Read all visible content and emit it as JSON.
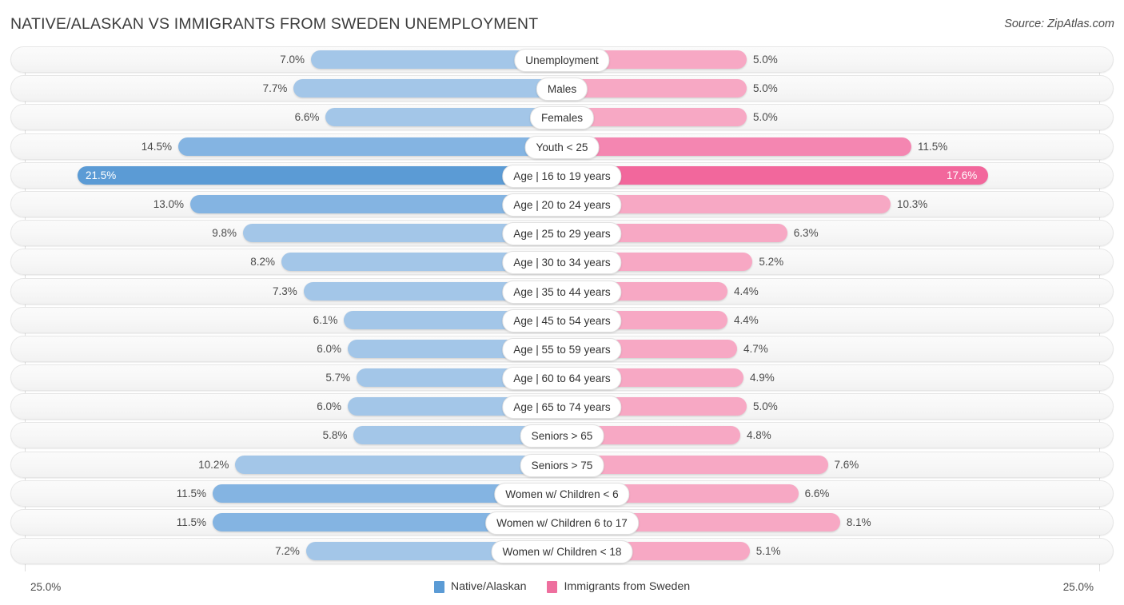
{
  "header": {
    "title": "NATIVE/ALASKAN VS IMMIGRANTS FROM SWEDEN UNEMPLOYMENT",
    "source": "Source: ZipAtlas.com"
  },
  "axis": {
    "left_label": "25.0%",
    "right_label": "25.0%",
    "max": 25.0
  },
  "legend": [
    {
      "label": "Native/Alaskan",
      "color": "#5b9bd5"
    },
    {
      "label": "Immigrants from Sweden",
      "color": "#ee6f9e"
    }
  ],
  "colors": {
    "left_light": "#a3c6e8",
    "left_mid": "#84b4e2",
    "left_strong": "#5b9bd5",
    "right_light": "#f7a8c4",
    "right_mid": "#f486b1",
    "right_strong": "#f2679c",
    "track": "#f7f7f7",
    "gridline": "#dedede"
  },
  "chart_data": {
    "type": "bar",
    "title": "NATIVE/ALASKAN VS IMMIGRANTS FROM SWEDEN UNEMPLOYMENT",
    "subtitle": "",
    "xlabel": "",
    "ylabel": "",
    "orientation": "horizontal-diverging",
    "xlim": [
      0,
      25.0
    ],
    "grid": true,
    "legend_position": "bottom-center",
    "categories": [
      "Unemployment",
      "Males",
      "Females",
      "Youth < 25",
      "Age | 16 to 19 years",
      "Age | 20 to 24 years",
      "Age | 25 to 29 years",
      "Age | 30 to 34 years",
      "Age | 35 to 44 years",
      "Age | 45 to 54 years",
      "Age | 55 to 59 years",
      "Age | 60 to 64 years",
      "Age | 65 to 74 years",
      "Seniors > 65",
      "Seniors > 75",
      "Women w/ Children < 6",
      "Women w/ Children 6 to 17",
      "Women w/ Children < 18"
    ],
    "series": [
      {
        "name": "Native/Alaskan",
        "color": "#5b9bd5",
        "values": [
          7.0,
          7.7,
          6.6,
          14.5,
          21.5,
          13.0,
          9.8,
          8.2,
          7.3,
          6.1,
          6.0,
          5.7,
          6.0,
          5.8,
          10.2,
          11.5,
          11.5,
          7.2
        ],
        "labels": [
          "7.0%",
          "7.7%",
          "6.6%",
          "14.5%",
          "21.5%",
          "13.0%",
          "9.8%",
          "8.2%",
          "7.3%",
          "6.1%",
          "6.0%",
          "5.7%",
          "6.0%",
          "5.8%",
          "10.2%",
          "11.5%",
          "11.5%",
          "7.2%"
        ]
      },
      {
        "name": "Immigrants from Sweden",
        "color": "#ee6f9e",
        "values": [
          5.0,
          5.0,
          5.0,
          11.5,
          17.6,
          10.3,
          6.3,
          5.2,
          4.4,
          4.4,
          4.7,
          4.9,
          5.0,
          4.8,
          7.6,
          6.6,
          8.1,
          5.1
        ],
        "labels": [
          "5.0%",
          "5.0%",
          "5.0%",
          "11.5%",
          "17.6%",
          "10.3%",
          "6.3%",
          "5.2%",
          "4.4%",
          "4.4%",
          "4.7%",
          "4.9%",
          "5.0%",
          "4.8%",
          "7.6%",
          "6.6%",
          "8.1%",
          "5.1%"
        ]
      }
    ],
    "highlighted_row": "Age | 16 to 19 years"
  }
}
